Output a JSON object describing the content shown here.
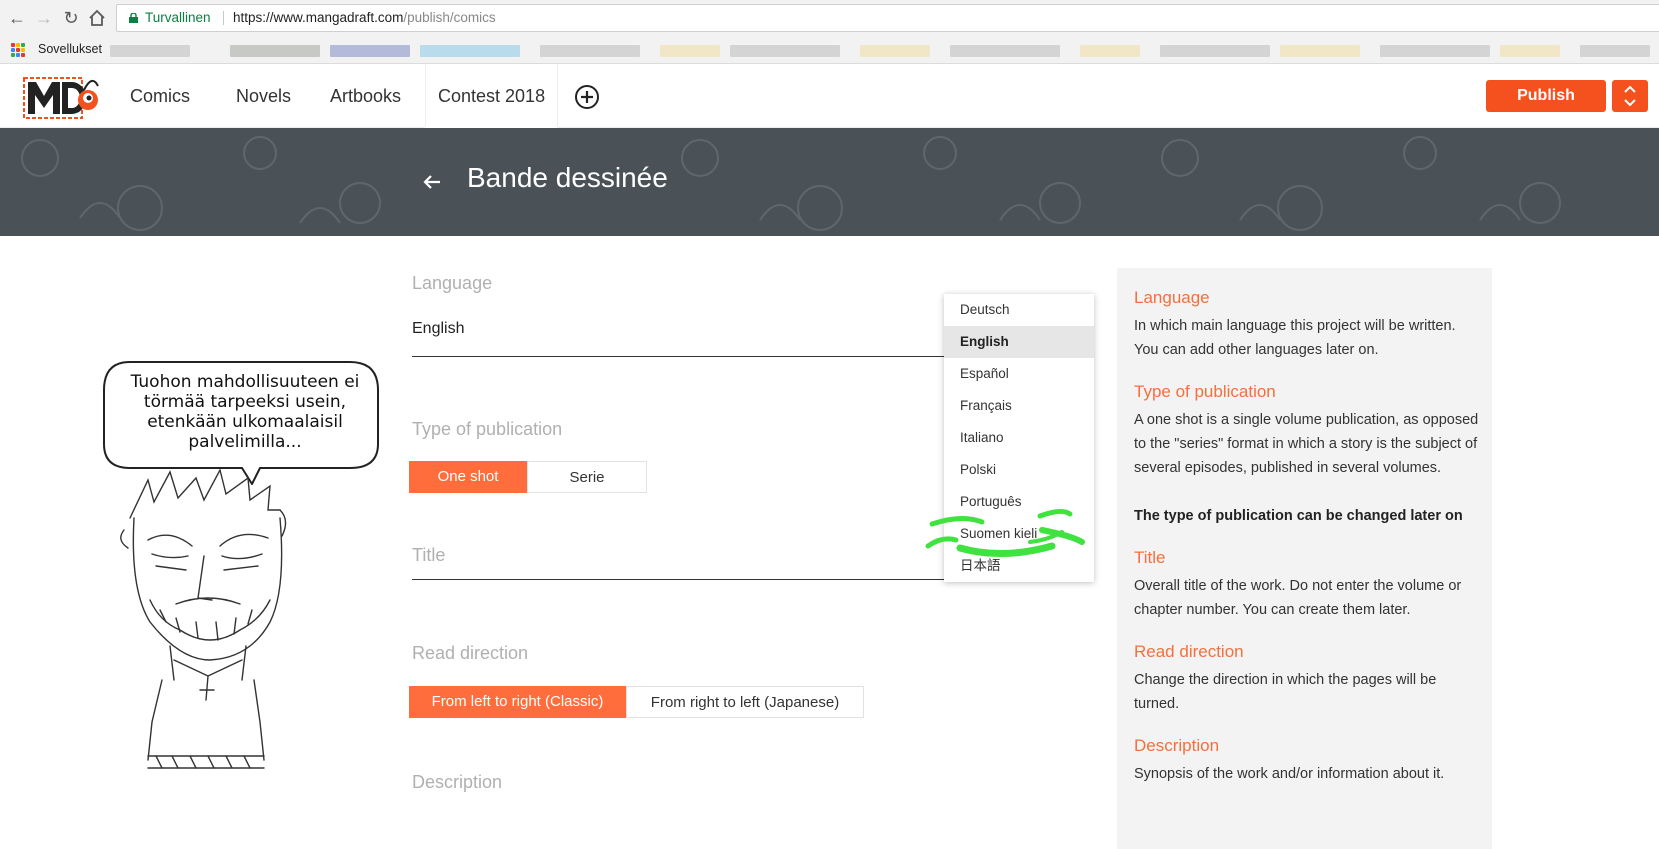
{
  "browser": {
    "secure_label": "Turvallinen",
    "url_host": "https://www.mangadraft.com",
    "url_path": "/publish/comics",
    "bookmarks_apps_label": "Sovellukset"
  },
  "header": {
    "nav": [
      "Comics",
      "Novels",
      "Artbooks",
      "Contest 2018"
    ],
    "publish_label": "Publish"
  },
  "banner": {
    "title": "Bande dessinée"
  },
  "form": {
    "language_label": "Language",
    "language_value": "English",
    "type_label": "Type of publication",
    "type_options": [
      "One shot",
      "Serie"
    ],
    "type_selected": "One shot",
    "title_label": "Title",
    "read_direction_label": "Read direction",
    "read_options": [
      "From left to right (Classic)",
      "From right to left (Japanese)"
    ],
    "read_selected": "From left to right (Classic)",
    "description_label": "Description"
  },
  "language_dropdown": {
    "options": [
      "Deutsch",
      "English",
      "Español",
      "Français",
      "Italiano",
      "Polski",
      "Português",
      "Suomen kieli",
      "日本語"
    ],
    "selected": "English"
  },
  "help": {
    "language_title": "Language",
    "language_text": "In which main language this project will be written. You can add other languages later on.",
    "type_title": "Type of publication",
    "type_text": "A one shot is a single volume publication, as opposed to the \"series\" format in which a story is the subject of several episodes, published in several volumes.",
    "type_note": "The type of publication can be changed later on",
    "title_title": "Title",
    "title_text": "Overall title of the work. Do not enter the volume or chapter number. You can create them later.",
    "read_title": "Read direction",
    "read_text": "Change the direction in which the pages will be turned.",
    "desc_title": "Description",
    "desc_text": "Synopsis of the work and/or information about it."
  },
  "comic": {
    "speech_bubble": "Tuohon mahdollisuuteen ei törmää tarpeeksi usein, etenkään ulkomaalaisil palvelimilla..."
  },
  "colors": {
    "accent": "#f4511e",
    "accent_light": "#ff6d3d",
    "banner": "#4a5257",
    "help_title": "#f4703c",
    "secure_green": "#0b8043"
  }
}
